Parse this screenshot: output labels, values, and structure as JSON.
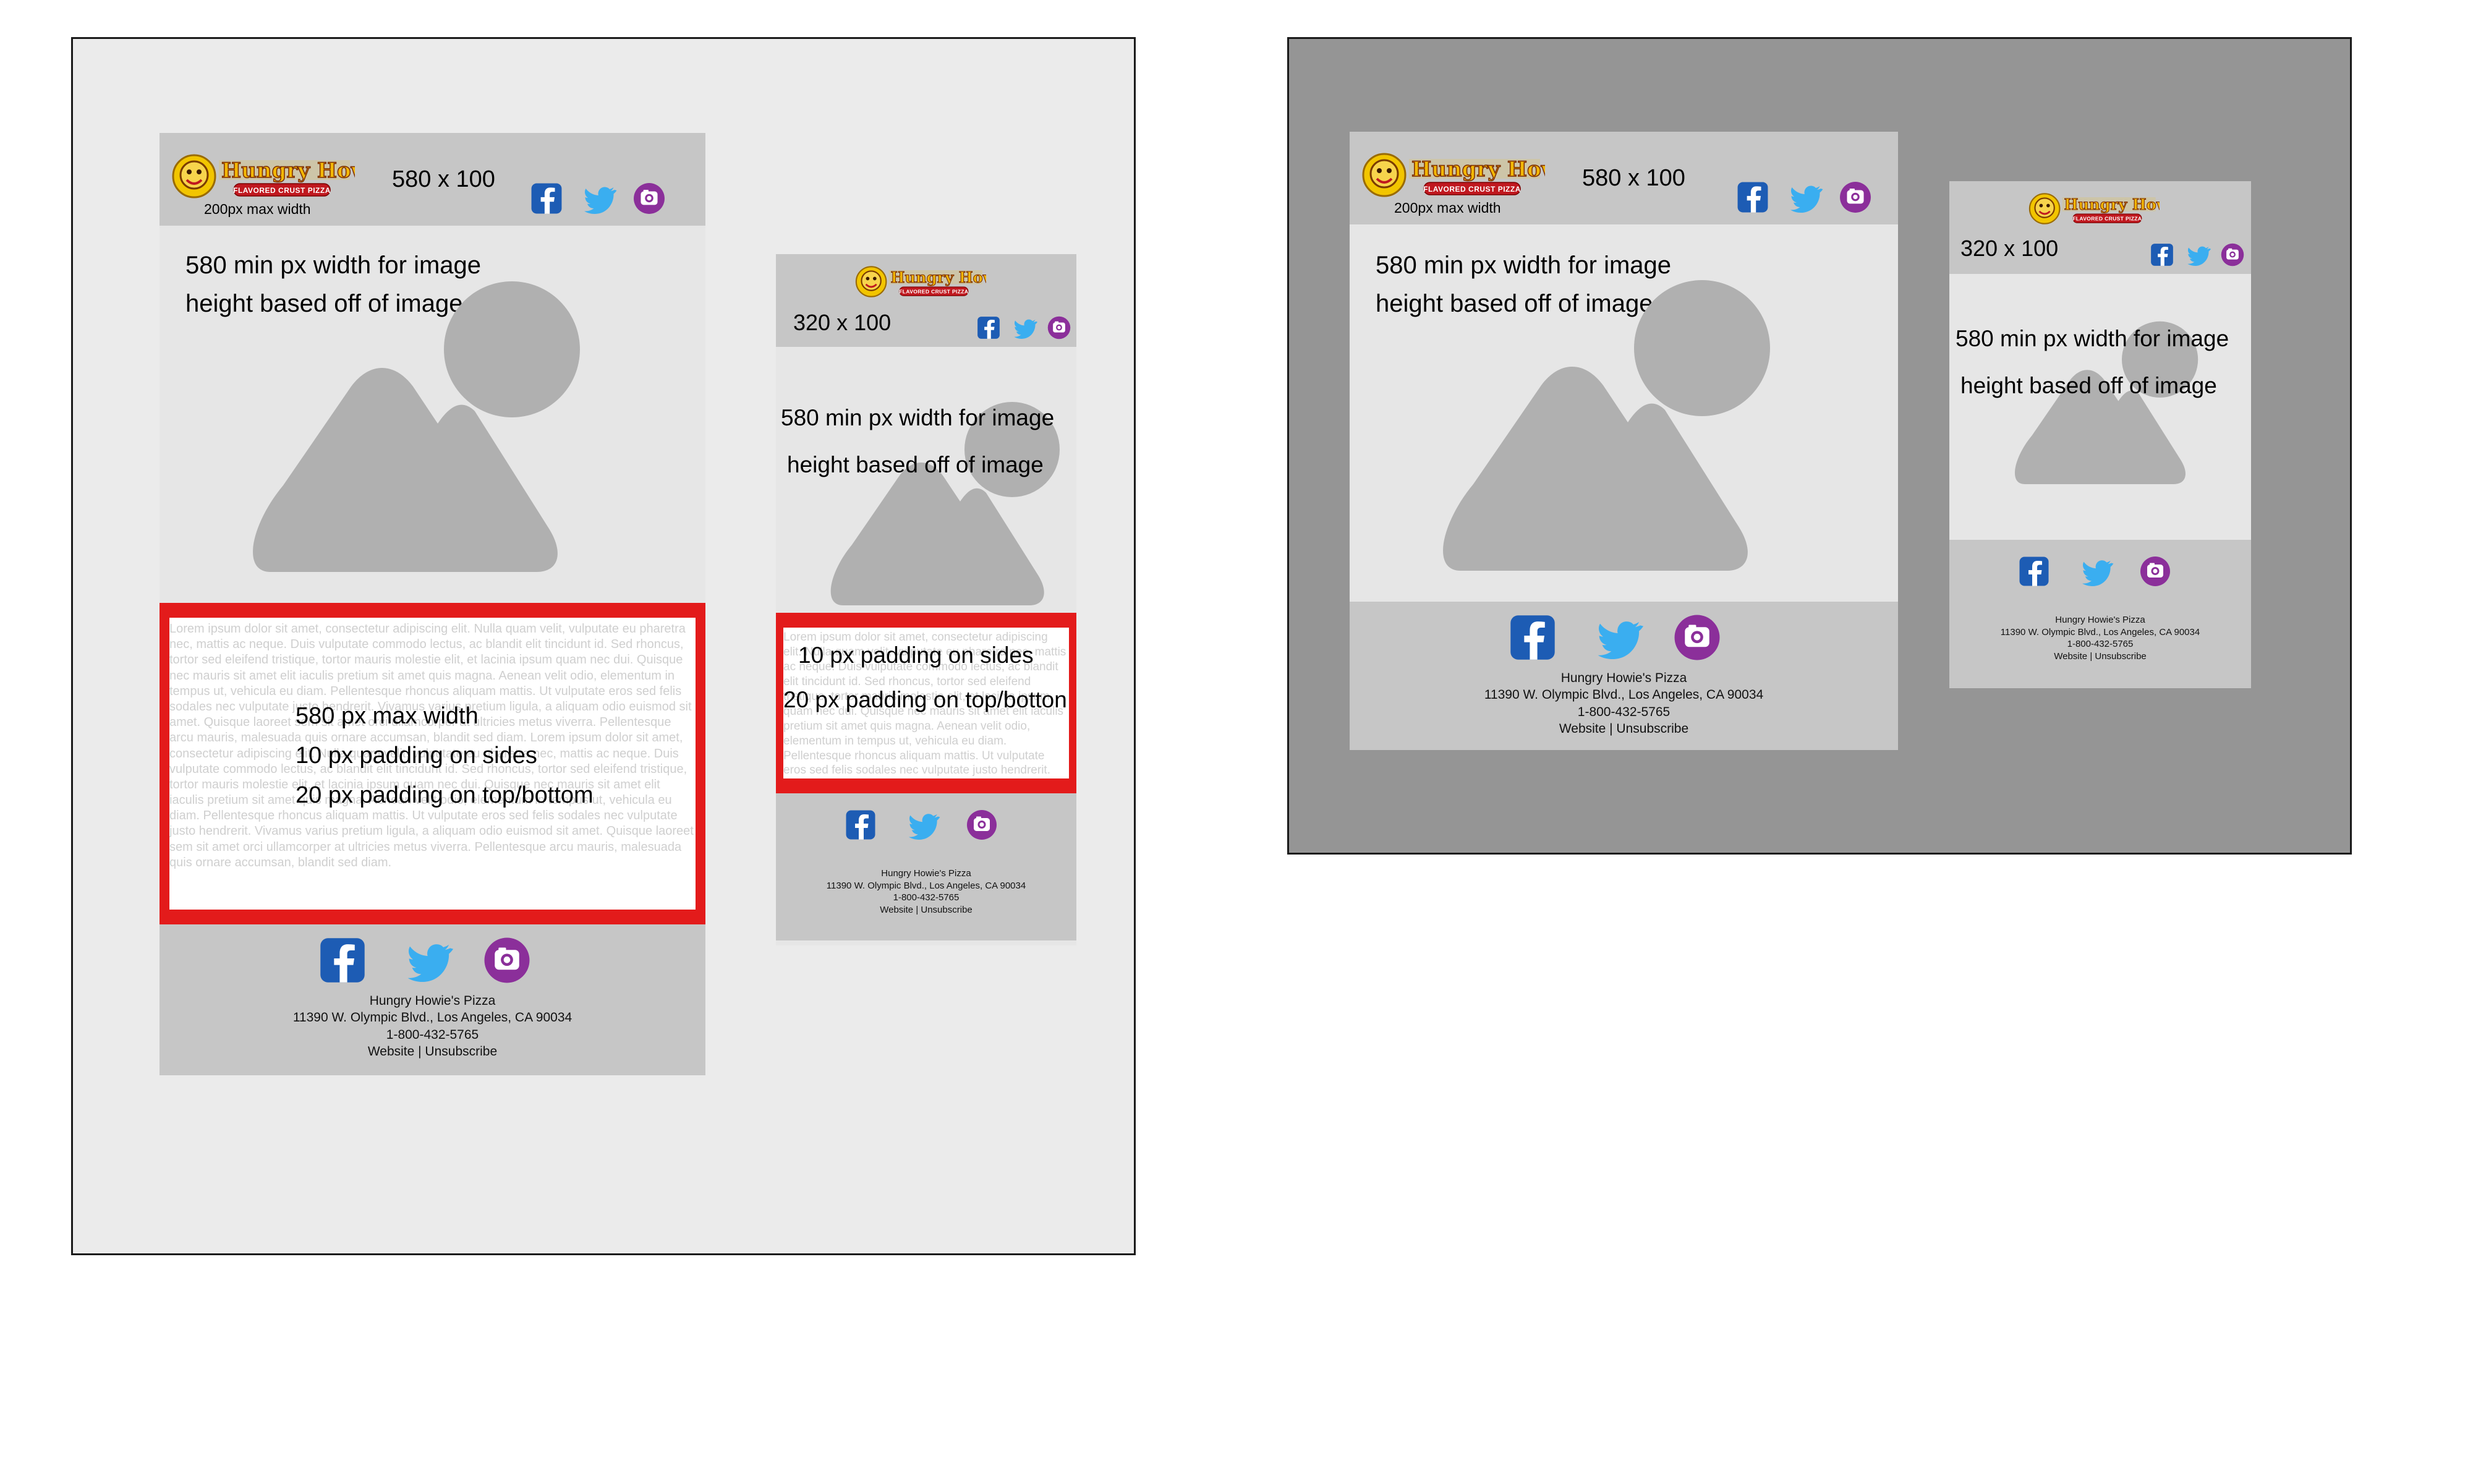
{
  "brand": {
    "name": "Hungry Howie's",
    "tagline": "FLAVORED CRUST PIZZA"
  },
  "labels": {
    "header_580": "580 x 100",
    "header_320": "320 x 100",
    "logo_max_width": "200px max width",
    "image_width": "580 min px width for image",
    "image_height": "height based off of image",
    "max_width": "580 px max width",
    "padding_sides": "10 px padding on sides",
    "padding_top_bottom": "20 px padding on top/bottom",
    "padding_top_bottom_clipped": "20 px padding on top/botton"
  },
  "lorem": "Lorem ipsum dolor sit amet, consectetur adipiscing elit. Nulla quam velit, vulputate eu pharetra nec, mattis ac neque. Duis vulputate commodo lectus, ac blandit elit tincidunt id. Sed rhoncus, tortor sed eleifend tristique, tortor mauris molestie elit, et lacinia ipsum quam nec dui. Quisque nec mauris sit amet elit iaculis pretium sit amet quis magna. Aenean velit odio, elementum in tempus ut, vehicula eu diam. Pellentesque rhoncus aliquam mattis. Ut vulputate eros sed felis sodales nec vulputate justo hendrerit. Vivamus varius pretium ligula, a aliquam odio euismod sit amet. Quisque laoreet sem sit amet orci ullamcorper at ultricies metus viverra. Pellentesque arcu mauris, malesuada quis ornare accumsan, blandit sed diam. Lorem ipsum dolor sit amet, consectetur adipiscing elit. Nulla quam velit, vulputate eu pharetra nec, mattis ac neque. Duis vulputate commodo lectus, ac blandit elit tincidunt id. Sed rhoncus, tortor sed eleifend tristique, tortor mauris molestie elit, et lacinia ipsum quam nec dui. Quisque nec mauris sit amet elit iaculis pretium sit amet quis magna. Aenean velit odio, elementum in tempus ut, vehicula eu diam. Pellentesque rhoncus aliquam mattis. Ut vulputate eros sed felis sodales nec vulputate justo hendrerit. Vivamus varius pretium ligula, a aliquam odio euismod sit amet. Quisque laoreet sem sit amet orci ullamcorper at ultricies metus viverra. Pellentesque arcu mauris, malesuada quis ornare accumsan, blandit sed diam.",
  "footer": {
    "company": "Hungry Howie's Pizza",
    "address": "11390 W. Olympic Blvd., Los Angeles, CA 90034",
    "phone": "1-800-432-5765",
    "links": "Website | Unsubscribe"
  },
  "icons": [
    "facebook-icon",
    "twitter-icon",
    "instagram-icon"
  ],
  "colors": {
    "facebook": "#1d5cb4",
    "twitter": "#3aaef0",
    "instagram": "#8b2f9a",
    "highlight": "#e31b1b",
    "mock_header": "#c6c6c6",
    "mock_body": "#e6e6e6",
    "panel_light": "#ebebeb",
    "panel_dark": "#959595"
  }
}
